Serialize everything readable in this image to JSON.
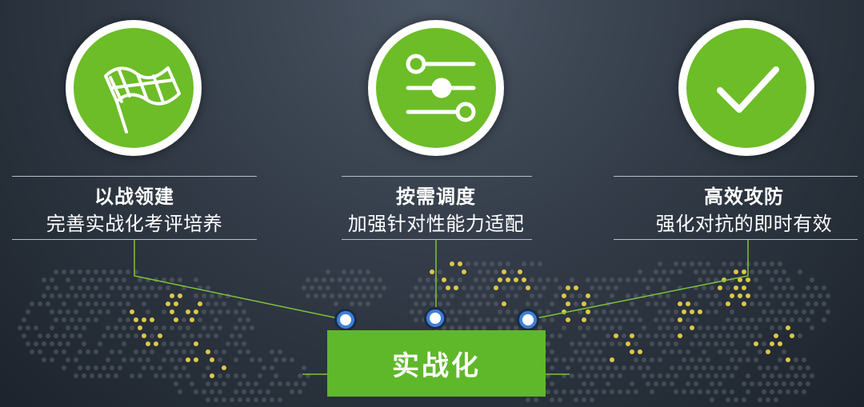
{
  "items": [
    {
      "title": "以战领建",
      "subtitle": "完善实战化考评培养",
      "icon": "racing-flag-icon"
    },
    {
      "title": "按需调度",
      "subtitle": "加强针对性能力适配",
      "icon": "sliders-icon"
    },
    {
      "title": "高效攻防",
      "subtitle": "强化对抗的即时有效",
      "icon": "checkmark-icon"
    }
  ],
  "center_label": "实战化",
  "colors": {
    "accent_green": "#6cbd27",
    "dot_yellow": "#e8d04a",
    "node_blue": "#3f7fd6"
  }
}
